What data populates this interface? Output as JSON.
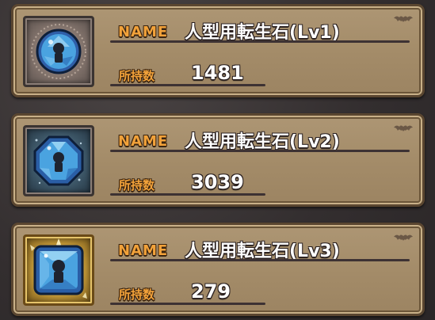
{
  "items": [
    {
      "name_label": "NAME",
      "name": "人型用転生石(Lv1)",
      "quantity_label": "所持数",
      "quantity": "1481",
      "icon": "round-blue-gem-icon",
      "frame_color": "#8a7a72"
    },
    {
      "name_label": "NAME",
      "name": "人型用転生石(Lv2)",
      "quantity_label": "所持数",
      "quantity": "3039",
      "icon": "octagon-blue-gem-icon",
      "frame_color": "#3e5869"
    },
    {
      "name_label": "NAME",
      "name": "人型用転生石(Lv3)",
      "quantity_label": "所持数",
      "quantity": "279",
      "icon": "square-blue-gem-icon",
      "frame_color": "#c99e3a"
    }
  ],
  "colors": {
    "label_orange": "#f2a23a",
    "card_tan": "#a38b68",
    "gem_blue": "#4aa3e0"
  }
}
